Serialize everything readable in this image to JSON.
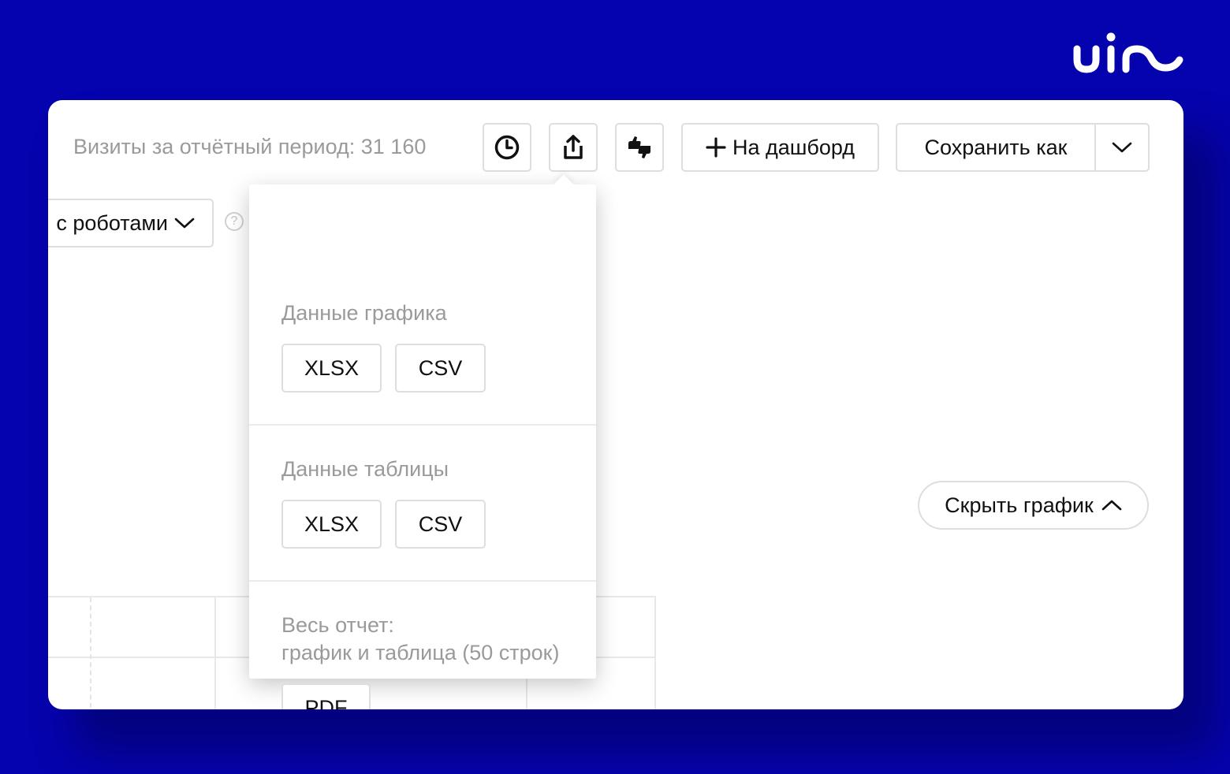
{
  "colors": {
    "background": "#0503ad",
    "card": "#ffffff",
    "muted_text": "#9a9a9a",
    "border": "#dedede"
  },
  "brand": {
    "logo_icon": "uis-logo-icon"
  },
  "header": {
    "visits_text": "Визиты за отчётный период: 31 160",
    "history_icon": "clock-icon",
    "export_icon": "share-export-icon",
    "feedback_icon": "thumbs-icon",
    "dashboard_label": "На дашборд",
    "save_as_label": "Сохранить как"
  },
  "filters": {
    "robots_label": "с роботами",
    "help_label": "?"
  },
  "chart_controls": {
    "hide_chart_label": "Скрыть график"
  },
  "export_menu": {
    "chart_section": {
      "title": "Данные графика",
      "formats": [
        "XLSX",
        "CSV"
      ]
    },
    "table_section": {
      "title": "Данные таблицы",
      "formats": [
        "XLSX",
        "CSV"
      ]
    },
    "report_section": {
      "title_line1": "Весь отчет:",
      "title_line2": "график и таблица (50 строк)",
      "formats": [
        "PDF"
      ]
    }
  }
}
